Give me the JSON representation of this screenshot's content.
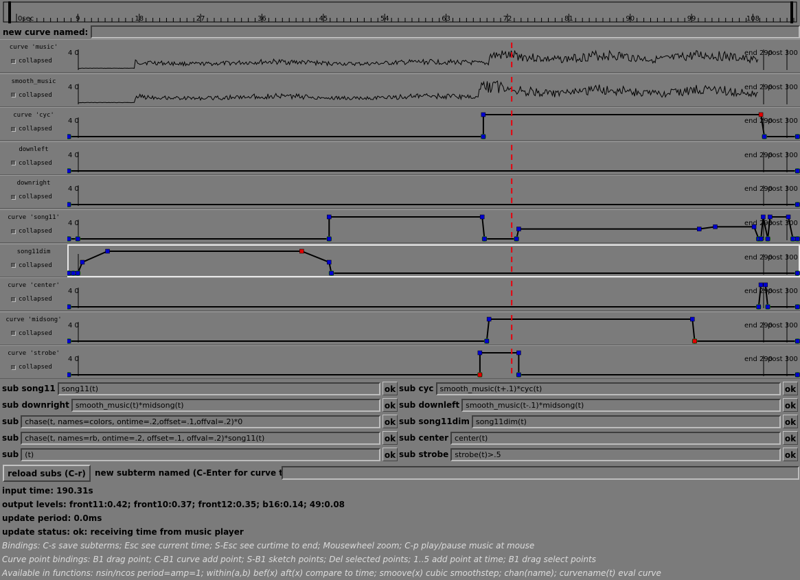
{
  "ruler": {
    "labels": [
      "0sec",
      "9",
      "18",
      "27",
      "36",
      "45",
      "54",
      "63",
      "72",
      "81",
      "90",
      "99",
      "108",
      "117",
      "126",
      "135",
      "144",
      "153",
      "162",
      "171",
      "180",
      "189",
      "198",
      "207",
      "216",
      "225",
      "234",
      "243",
      "252",
      "261",
      "270",
      "279",
      "288",
      "297"
    ],
    "current_time": 190.31,
    "colors": {
      "cursor": "#e8000c",
      "line": "#000000"
    }
  },
  "new_curve": {
    "label": "new curve named:",
    "value": ""
  },
  "curves": [
    {
      "name": "curve 'music'",
      "collapsed_label": "collapsed",
      "kind": "audio",
      "y_label": "4 0",
      "end_label": "end 290",
      "post_label": "post 300"
    },
    {
      "name": "smooth_music",
      "collapsed_label": "collapsed",
      "kind": "audio",
      "y_label": "4 0",
      "end_label": "end 290",
      "post_label": "post 300"
    },
    {
      "name": "curve 'cyc'",
      "collapsed_label": "collapsed",
      "kind": "points",
      "y_label": "4 0",
      "end_label": "end 290",
      "post_label": "post 300"
    },
    {
      "name": "downleft",
      "collapsed_label": "collapsed",
      "kind": "points",
      "y_label": "4 0",
      "end_label": "end 290",
      "post_label": "post 300"
    },
    {
      "name": "downright",
      "collapsed_label": "collapsed",
      "kind": "points",
      "y_label": "4 0",
      "end_label": "end 290",
      "post_label": "post 300"
    },
    {
      "name": "curve 'song11'",
      "collapsed_label": "collapsed",
      "kind": "points",
      "y_label": "4 0",
      "end_label": "end 290",
      "post_label": "post 300"
    },
    {
      "name": "song11dim",
      "collapsed_label": "collapsed",
      "kind": "points",
      "y_label": "",
      "end_label": "end 290",
      "post_label": "post 300",
      "selected": true
    },
    {
      "name": "curve 'center'",
      "collapsed_label": "collapsed",
      "kind": "points",
      "y_label": "4 0",
      "end_label": "end 290",
      "post_label": "post 300"
    },
    {
      "name": "curve 'midsong'",
      "collapsed_label": "collapsed",
      "kind": "points",
      "y_label": "4 0",
      "end_label": "end 290",
      "post_label": "post 300"
    },
    {
      "name": "curve 'strobe'",
      "collapsed_label": "collapsed",
      "kind": "points",
      "y_label": "4 0",
      "end_label": "end 290",
      "post_label": "post 300"
    }
  ],
  "subs": [
    {
      "label": "sub song11",
      "expr": "song11(t)",
      "ok": "ok"
    },
    {
      "label": "sub cyc",
      "expr": "smooth_music(t+.1)*cyc(t)",
      "ok": "ok"
    },
    {
      "label": "sub downright",
      "expr": "smooth_music(t)*midsong(t)",
      "ok": "ok"
    },
    {
      "label": "sub downleft",
      "expr": "smooth_music(t-.1)*midsong(t)",
      "ok": "ok"
    },
    {
      "label": "sub",
      "expr": "chase(t, names=colors, ontime=.2,offset=.1,offval=.2)*0",
      "ok": "ok"
    },
    {
      "label": "sub song11dim",
      "expr": "song11dim(t)",
      "ok": "ok"
    },
    {
      "label": "sub",
      "expr": "chase(t, names=rb, ontime=.2, offset=.1, offval=.2)*song11(t)",
      "ok": "ok"
    },
    {
      "label": "sub center",
      "expr": "center(t)",
      "ok": "ok"
    },
    {
      "label": "sub",
      "expr": "(t)",
      "ok": "ok"
    },
    {
      "label": "sub strobe",
      "expr": "strobe(t)>.5",
      "ok": "ok"
    }
  ],
  "reload_button": "reload subs (C-r)",
  "new_subterm": {
    "label": "new subterm named (C-Enter for curve too):",
    "value": ""
  },
  "status": {
    "input_time": "input time: 190.31s",
    "output_levels": "output levels: front11:0.42; front10:0.37; front12:0.35; b16:0.14; 49:0.08",
    "update_period": "update period: 0.0ms",
    "update_status": "update status: ok: receiving time from music player"
  },
  "help": [
    "Bindings: C-s save subterms;  Esc see current time; S-Esc see curtime to end; Mousewheel zoom; C-p play/pause music at mouse",
    "Curve point bindings: B1 drag point; C-B1 curve add point; S-B1 sketch points; Del selected points; 1..5 add point at time; B1 drag select points",
    "Available in functions: nsin/ncos period=amp=1; within(a,b) bef(x) aft(x) compare to time; smoove(x) cubic smoothstep; chan(name); curvename(t) eval curve"
  ]
}
